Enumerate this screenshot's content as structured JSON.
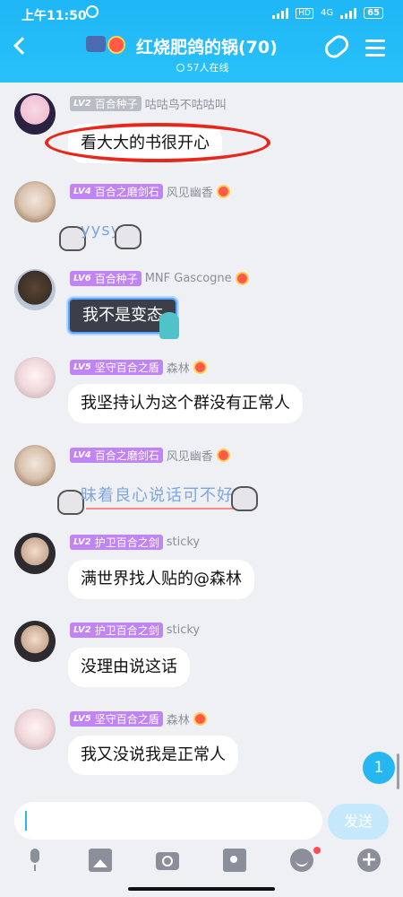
{
  "status_bar": {
    "time": "上午11:50",
    "network": "4G",
    "hd": "HD",
    "battery": "65"
  },
  "header": {
    "title": "红烧肥鸽的锅(70)",
    "online": "57人在线"
  },
  "messages": [
    {
      "level": "LV2",
      "title": "百合种子",
      "name": "咕咕鸟不咕咕叫",
      "text": "看大大的书很开心",
      "kind": "bubble",
      "highlighted": true
    },
    {
      "level": "LV4",
      "title": "百合之磨剑石",
      "name": "风见幽香",
      "text": "yysy",
      "kind": "sticker"
    },
    {
      "level": "LV6",
      "title": "百合种子",
      "name": "MNF Gascogne",
      "text": "我不是变态",
      "kind": "dark-bubble"
    },
    {
      "level": "LV5",
      "title": "坚守百合之盾",
      "name": "森林",
      "text": "我坚持认为这个群没有正常人",
      "kind": "bubble"
    },
    {
      "level": "LV4",
      "title": "百合之磨剑石",
      "name": "风见幽香",
      "text": "昧着良心说话可不好",
      "kind": "sticker"
    },
    {
      "level": "LV2",
      "title": "护卫百合之剑",
      "name": "sticky",
      "text": "满世界找人贴的@森林",
      "kind": "bubble"
    },
    {
      "level": "LV2",
      "title": "护卫百合之剑",
      "name": "sticky",
      "text": "没理由说这话",
      "kind": "bubble"
    },
    {
      "level": "LV5",
      "title": "坚守百合之盾",
      "name": "森林",
      "text": "我又没说我是正常人",
      "kind": "bubble"
    }
  ],
  "unread_count": "1",
  "input": {
    "send_label": "发送"
  },
  "toolbar": {
    "icons": [
      "mic-icon",
      "image-icon",
      "camera-icon",
      "red-packet-icon",
      "emoji-icon",
      "plus-icon"
    ]
  },
  "colors": {
    "header": "#1fb6f5",
    "highlight_oval": "#e8261c",
    "level_purple": "#c084f5"
  }
}
